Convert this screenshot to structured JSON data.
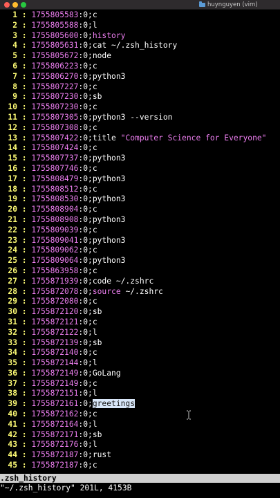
{
  "window": {
    "title": "huynguyen (vim)"
  },
  "lines": [
    {
      "n": "1",
      "ts": "1755805583",
      "cmd": "c"
    },
    {
      "n": "2",
      "ts": "1755805588",
      "cmd": "l"
    },
    {
      "n": "3",
      "ts": "1755805600",
      "cmd": "history",
      "kw": true
    },
    {
      "n": "4",
      "ts": "1755805631",
      "cmd": "cat ~/.zsh_history"
    },
    {
      "n": "5",
      "ts": "1755805672",
      "cmd": "node"
    },
    {
      "n": "6",
      "ts": "1755806223",
      "cmd": "c"
    },
    {
      "n": "7",
      "ts": "1755806270",
      "cmd": "python3"
    },
    {
      "n": "8",
      "ts": "1755807227",
      "cmd": "c"
    },
    {
      "n": "9",
      "ts": "1755807230",
      "cmd": "sb"
    },
    {
      "n": "10",
      "ts": "1755807230",
      "cmd": "c"
    },
    {
      "n": "11",
      "ts": "1755807305",
      "cmd": "python3 --version"
    },
    {
      "n": "12",
      "ts": "1755807308",
      "cmd": "c"
    },
    {
      "n": "13",
      "ts": "1755807422",
      "cmd": "title ",
      "str": "\"Computer Science for Everyone\""
    },
    {
      "n": "14",
      "ts": "1755807424",
      "cmd": "c"
    },
    {
      "n": "15",
      "ts": "1755807737",
      "cmd": "python3"
    },
    {
      "n": "16",
      "ts": "1755807746",
      "cmd": "c"
    },
    {
      "n": "17",
      "ts": "1755808479",
      "cmd": "python3"
    },
    {
      "n": "18",
      "ts": "1755808512",
      "cmd": "c"
    },
    {
      "n": "19",
      "ts": "1755808530",
      "cmd": "python3"
    },
    {
      "n": "20",
      "ts": "1755808904",
      "cmd": "c"
    },
    {
      "n": "21",
      "ts": "1755808908",
      "cmd": "python3"
    },
    {
      "n": "22",
      "ts": "1755809039",
      "cmd": "c"
    },
    {
      "n": "23",
      "ts": "1755809041",
      "cmd": "python3"
    },
    {
      "n": "24",
      "ts": "1755809062",
      "cmd": "c"
    },
    {
      "n": "25",
      "ts": "1755809064",
      "cmd": "python3"
    },
    {
      "n": "26",
      "ts": "1755863958",
      "cmd": "c"
    },
    {
      "n": "27",
      "ts": "1755871939",
      "cmd": "code ~/.zshrc"
    },
    {
      "n": "28",
      "ts": "1755872078",
      "cmd": "~/.zshrc",
      "pre": "source ",
      "prekw": true
    },
    {
      "n": "29",
      "ts": "1755872080",
      "cmd": "c"
    },
    {
      "n": "30",
      "ts": "1755872120",
      "cmd": "sb"
    },
    {
      "n": "31",
      "ts": "1755872121",
      "cmd": "c"
    },
    {
      "n": "32",
      "ts": "1755872122",
      "cmd": "l"
    },
    {
      "n": "33",
      "ts": "1755872139",
      "cmd": "sb"
    },
    {
      "n": "34",
      "ts": "1755872140",
      "cmd": "c"
    },
    {
      "n": "35",
      "ts": "1755872144",
      "cmd": "l"
    },
    {
      "n": "36",
      "ts": "1755872149",
      "cmd": "GoLang"
    },
    {
      "n": "37",
      "ts": "1755872149",
      "cmd": "c"
    },
    {
      "n": "38",
      "ts": "1755872151",
      "cmd": "l"
    },
    {
      "n": "39",
      "ts": "1755872161",
      "cmd": "greetings",
      "hl": true
    },
    {
      "n": "40",
      "ts": "1755872162",
      "cmd": "c"
    },
    {
      "n": "41",
      "ts": "1755872164",
      "cmd": "l"
    },
    {
      "n": "42",
      "ts": "1755872171",
      "cmd": "sb"
    },
    {
      "n": "43",
      "ts": "1755872176",
      "cmd": "l"
    },
    {
      "n": "44",
      "ts": "1755872187",
      "cmd": "rust"
    },
    {
      "n": "45",
      "ts": "1755872187",
      "cmd": "c"
    }
  ],
  "statusline": {
    "filename": ".zsh_history"
  },
  "cmdline": {
    "message": "\"~/.zsh_history\" 201L, 4153B"
  },
  "icons": {
    "folder": "folder-icon",
    "cursor": "ibeam-cursor-icon"
  }
}
